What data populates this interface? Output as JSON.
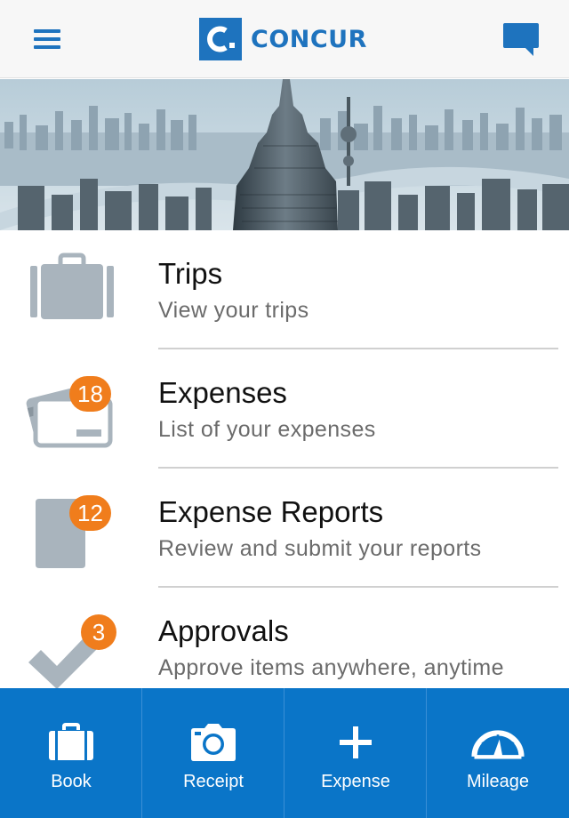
{
  "header": {
    "brand_name": "CONCUR",
    "menu_icon": "hamburger-menu-icon",
    "chat_icon": "chat-bubble-icon",
    "accent_color": "#1e73be"
  },
  "hero": {
    "image": "city-skyline-photo"
  },
  "menu": {
    "items": [
      {
        "title": "Trips",
        "subtitle": "View your trips",
        "icon": "briefcase-icon",
        "badge": ""
      },
      {
        "title": "Expenses",
        "subtitle": "List of your expenses",
        "icon": "credit-card-icon",
        "badge": "18"
      },
      {
        "title": "Expense Reports",
        "subtitle": "Review and submit your reports",
        "icon": "report-icon",
        "badge": "12"
      },
      {
        "title": "Approvals",
        "subtitle": "Approve items anywhere, anytime",
        "icon": "checkmark-icon",
        "badge": "3"
      }
    ],
    "badge_color": "#f07d1c"
  },
  "toolbar": {
    "color": "#0a75c8",
    "items": [
      {
        "label": "Book",
        "icon": "briefcase-icon"
      },
      {
        "label": "Receipt",
        "icon": "camera-icon"
      },
      {
        "label": "Expense",
        "icon": "plus-icon"
      },
      {
        "label": "Mileage",
        "icon": "speedometer-icon"
      }
    ]
  }
}
